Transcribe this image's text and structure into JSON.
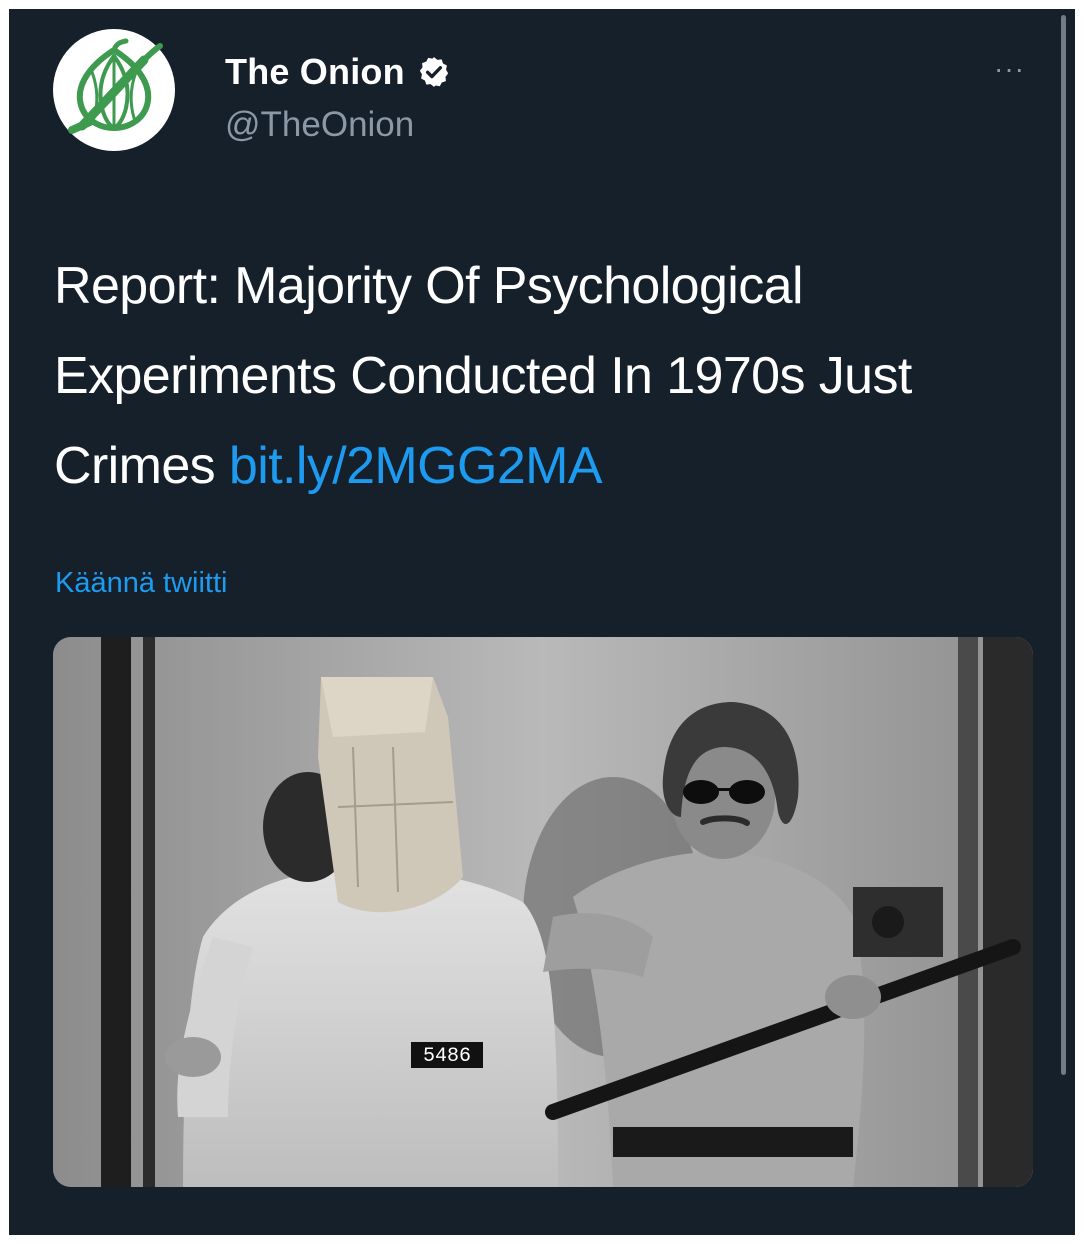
{
  "tweet": {
    "author": {
      "display_name": "The Onion",
      "handle": "@TheOnion",
      "verified": true,
      "avatar_icon": "onion-logo-icon",
      "brand_color": "#3d9a4f"
    },
    "more_label": "···",
    "text": "Report: Majority Of Psychological Experiments Conducted In 1970s Just Crimes",
    "link": "bit.ly/2MGG2MA",
    "translate_label": "Käännä twiitti",
    "media": {
      "prisoner_number": "5486"
    }
  },
  "colors": {
    "background": "#15202b",
    "text": "#ffffff",
    "secondary_text": "#8b98a5",
    "link": "#1d9bf0"
  }
}
